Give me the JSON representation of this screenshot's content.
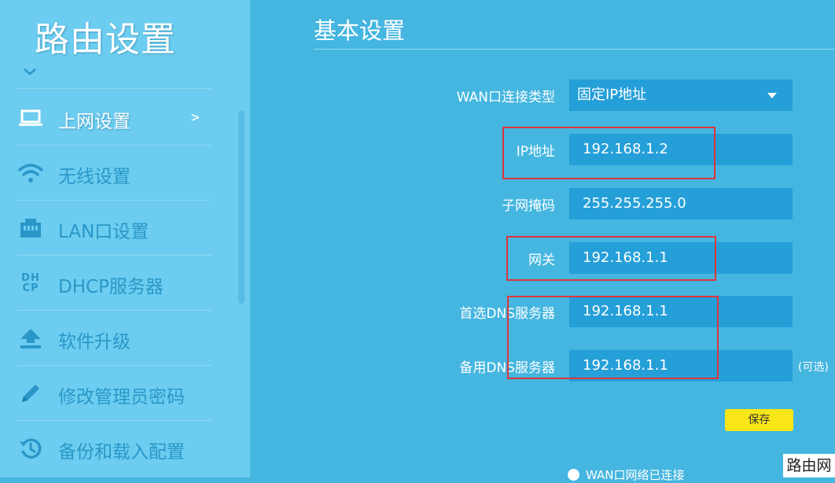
{
  "brand": {
    "title": "路由设置"
  },
  "sidebar": {
    "items": [
      {
        "label": "上网设置",
        "icon": "laptop-icon",
        "active": true,
        "chevron": ">"
      },
      {
        "label": "无线设置",
        "icon": "wifi-icon"
      },
      {
        "label": "LAN口设置",
        "icon": "lan-port-icon"
      },
      {
        "label": "DHCP服务器",
        "icon": "dhcp-icon",
        "icon_text_top": "DH",
        "icon_text_bottom": "CP"
      },
      {
        "label": "软件升级",
        "icon": "upload-icon"
      },
      {
        "label": "修改管理员密码",
        "icon": "pencil-icon"
      },
      {
        "label": "备份和载入配置",
        "icon": "restore-icon"
      }
    ]
  },
  "main": {
    "title": "基本设置",
    "form": {
      "wan_type_label": "WAN口连接类型",
      "wan_type_value": "固定IP地址",
      "ip_label": "IP地址",
      "ip_value": "192.168.1.2",
      "mask_label": "子网掩码",
      "mask_value": "255.255.255.0",
      "gateway_label": "网关",
      "gateway_value": "192.168.1.1",
      "dns1_label": "首选DNS服务器",
      "dns1_value": "192.168.1.1",
      "dns2_label": "备用DNS服务器",
      "dns2_value": "192.168.1.1",
      "dns2_optional": "(可选)"
    },
    "save_label": "保存",
    "status_text": "WAN口网络已连接"
  },
  "watermark": "路由网",
  "colors": {
    "background": "#44b6e0",
    "sidebar": "#6ccdf0",
    "field": "#259fd8",
    "save_button": "#f9e619",
    "highlight_box": "#e0343a"
  }
}
